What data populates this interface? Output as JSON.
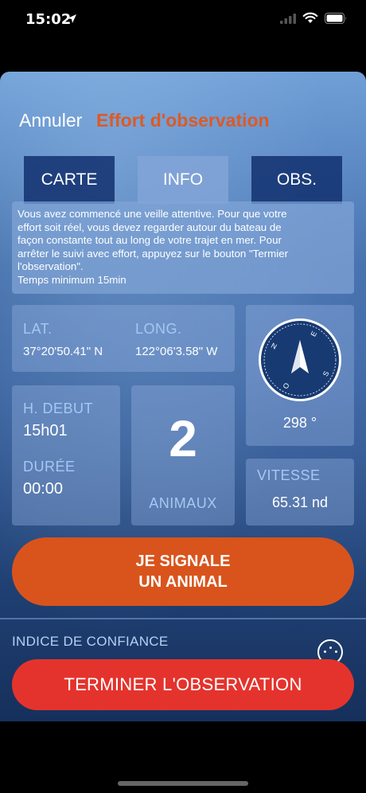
{
  "status": {
    "time": "15:02"
  },
  "nav": {
    "cancel_label": "Annuler",
    "title": "Effort d'observation"
  },
  "tabs": [
    {
      "label": "CARTE",
      "active": false
    },
    {
      "label": "INFO",
      "active": true
    },
    {
      "label": "OBS.",
      "active": false
    }
  ],
  "info_text": {
    "line1": "Vous avez commencé une veille attentive. Pour que votre",
    "line2": "effort soit réel, vous devez regarder autour du bateau de",
    "line3": "façon constante tout au long de votre trajet en mer. Pour",
    "line4": "arrêter le suivi avec effort, appuyez sur le bouton \"Termier",
    "line5": "l'observation\".",
    "line6": "Temps minimum 15min"
  },
  "coords": {
    "lat_label": "LAT.",
    "lat_value": "37°20'50.41\" N",
    "long_label": "LONG.",
    "long_value": "122°06'3.58\" W"
  },
  "compass": {
    "heading_value": "298 °",
    "heading_degrees": 298,
    "letters": [
      "N",
      "E",
      "S",
      "O"
    ]
  },
  "start": {
    "label": "H. DEBUT",
    "value": "15h01"
  },
  "duration": {
    "label": "DURÉE",
    "value": "00:00"
  },
  "animals": {
    "count": "2",
    "label": "ANIMAUX"
  },
  "speed": {
    "label": "VITESSE",
    "value": "65.31 nd"
  },
  "report_button": {
    "line1": "JE SIGNALE",
    "line2": "UN ANIMAL"
  },
  "confidence": {
    "label": "INDICE DE CONFIANCE"
  },
  "end_button": {
    "label": "TERMINER L'OBSERVATION"
  },
  "colors": {
    "title_orange": "#dc5a26",
    "report_orange": "#d9541c",
    "end_red": "#e4332c",
    "label_blue": "#a7c7f3",
    "compass_navy": "#173a72"
  },
  "icons": [
    "location-arrow-icon",
    "signal-icon",
    "wifi-icon",
    "battery-icon",
    "compass-icon",
    "info-circle-icon"
  ]
}
